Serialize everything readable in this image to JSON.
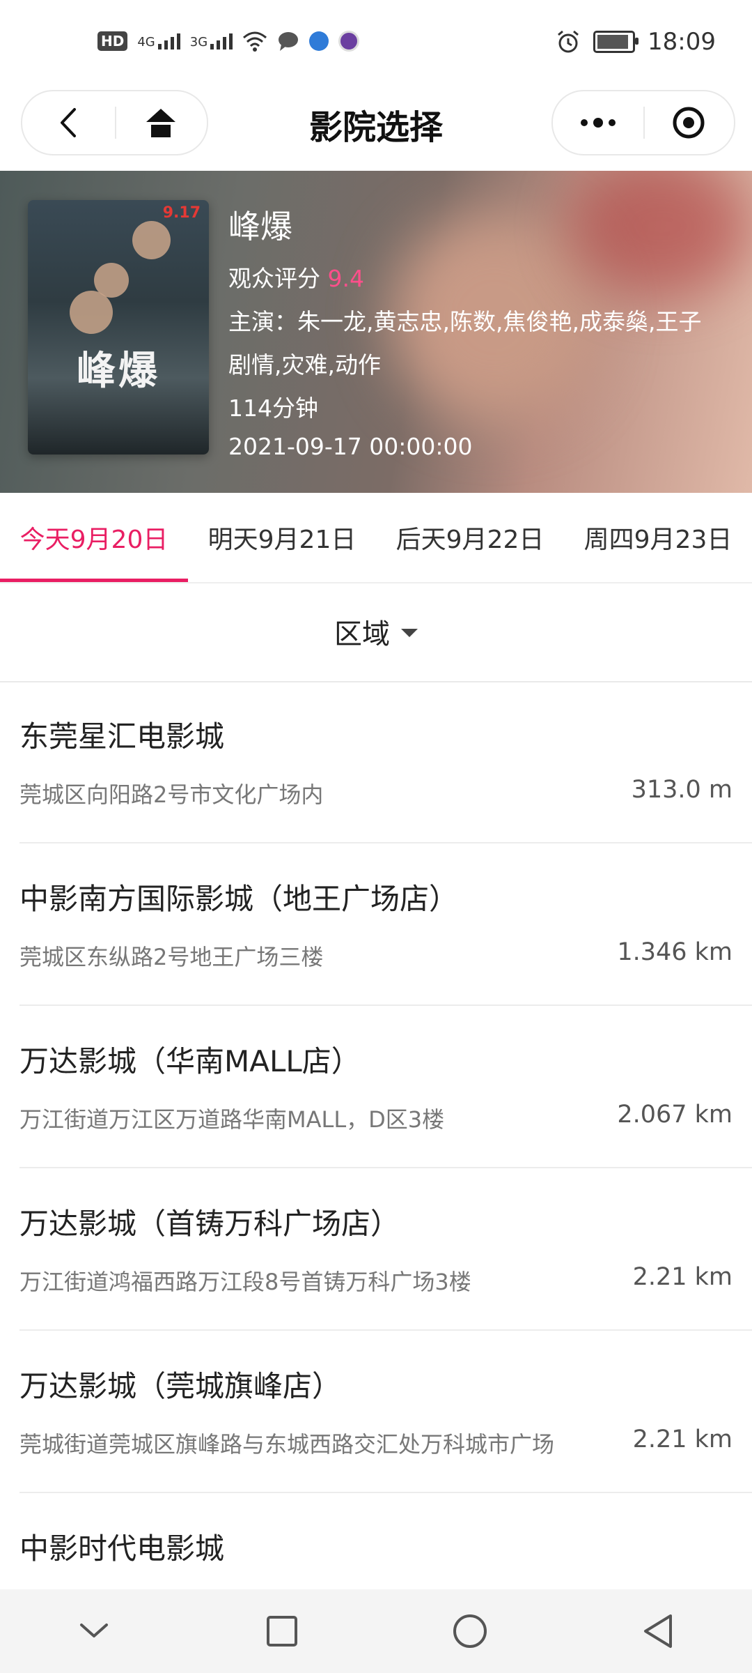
{
  "status_bar": {
    "badge": "HD",
    "net1": "4G",
    "net2": "3G",
    "time": "18:09"
  },
  "nav": {
    "title": "影院选择"
  },
  "movie": {
    "title": "峰爆",
    "score_label": "观众评分",
    "score": "9.4",
    "cast": "主演：朱一龙,黄志忠,陈数,焦俊艳,成泰燊,王子",
    "genres": "剧情,灾难,动作",
    "duration": "114分钟",
    "release": "2021-09-17 00:00:00",
    "poster": {
      "title": "峰爆",
      "date_badge": "9.17"
    }
  },
  "date_tabs": [
    {
      "label": "今天9月20日",
      "active": true
    },
    {
      "label": "明天9月21日",
      "active": false
    },
    {
      "label": "后天9月22日",
      "active": false
    },
    {
      "label": "周四9月23日",
      "active": false
    }
  ],
  "filter": {
    "region_label": "区域"
  },
  "cinemas": [
    {
      "name": "东莞星汇电影城",
      "address": "莞城区向阳路2号市文化广场内",
      "distance": "313.0 m"
    },
    {
      "name": "中影南方国际影城（地王广场店）",
      "address": "莞城区东纵路2号地王广场三楼",
      "distance": "1.346 km"
    },
    {
      "name": "万达影城（华南MALL店）",
      "address": "万江街道万江区万道路华南MALL，D区3楼",
      "distance": "2.067 km"
    },
    {
      "name": "万达影城（首铸万科广场店）",
      "address": "万江街道鸿福西路万江段8号首铸万科广场3楼",
      "distance": "2.21 km"
    },
    {
      "name": "万达影城（莞城旗峰店）",
      "address": "莞城街道莞城区旗峰路与东城西路交汇处万科城市广场",
      "distance": "2.21 km"
    },
    {
      "name": "中影时代电影城",
      "address": "",
      "distance": ""
    }
  ],
  "colors": {
    "accent": "#e91e63",
    "score": "#ff4f8b"
  }
}
